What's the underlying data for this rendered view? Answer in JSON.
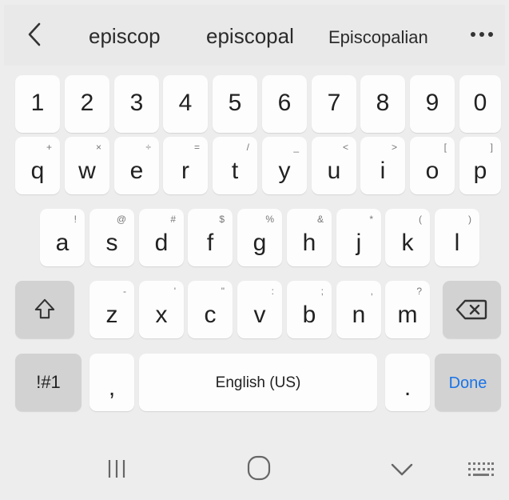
{
  "suggestions": {
    "back_icon": "chevron-left-icon",
    "items": [
      "episcop",
      "episcopal",
      "Episcopalian"
    ],
    "more_icon": "more-horizontal-icon"
  },
  "number_row": [
    "1",
    "2",
    "3",
    "4",
    "5",
    "6",
    "7",
    "8",
    "9",
    "0"
  ],
  "row1": {
    "keys": [
      "q",
      "w",
      "e",
      "r",
      "t",
      "y",
      "u",
      "i",
      "o",
      "p"
    ],
    "hints": [
      "+",
      "×",
      "÷",
      "=",
      "/",
      "_",
      "<",
      ">",
      "[",
      "]"
    ]
  },
  "row2": {
    "keys": [
      "a",
      "s",
      "d",
      "f",
      "g",
      "h",
      "j",
      "k",
      "l"
    ],
    "hints": [
      "!",
      "@",
      "#",
      "$",
      "%",
      "&",
      "*",
      "(",
      ")"
    ]
  },
  "row3": {
    "keys": [
      "z",
      "x",
      "c",
      "v",
      "b",
      "n",
      "m"
    ],
    "hints": [
      "-",
      "'",
      "\"",
      ":",
      ";",
      ",",
      "?"
    ],
    "shift_icon": "shift-icon",
    "backspace_icon": "backspace-icon"
  },
  "row4": {
    "symbols": "!#1",
    "comma": ",",
    "space": "English (US)",
    "period": ".",
    "done": "Done"
  },
  "nav": {
    "recents_icon": "recents-icon",
    "home_icon": "home-icon",
    "back_icon": "nav-down-chevron-icon",
    "keyboard_icon": "keyboard-icon"
  },
  "colors": {
    "accent": "#1a73e8",
    "key_bg": "#fdfdfd",
    "dark_key_bg": "#d2d2d2",
    "background": "#ededed"
  }
}
